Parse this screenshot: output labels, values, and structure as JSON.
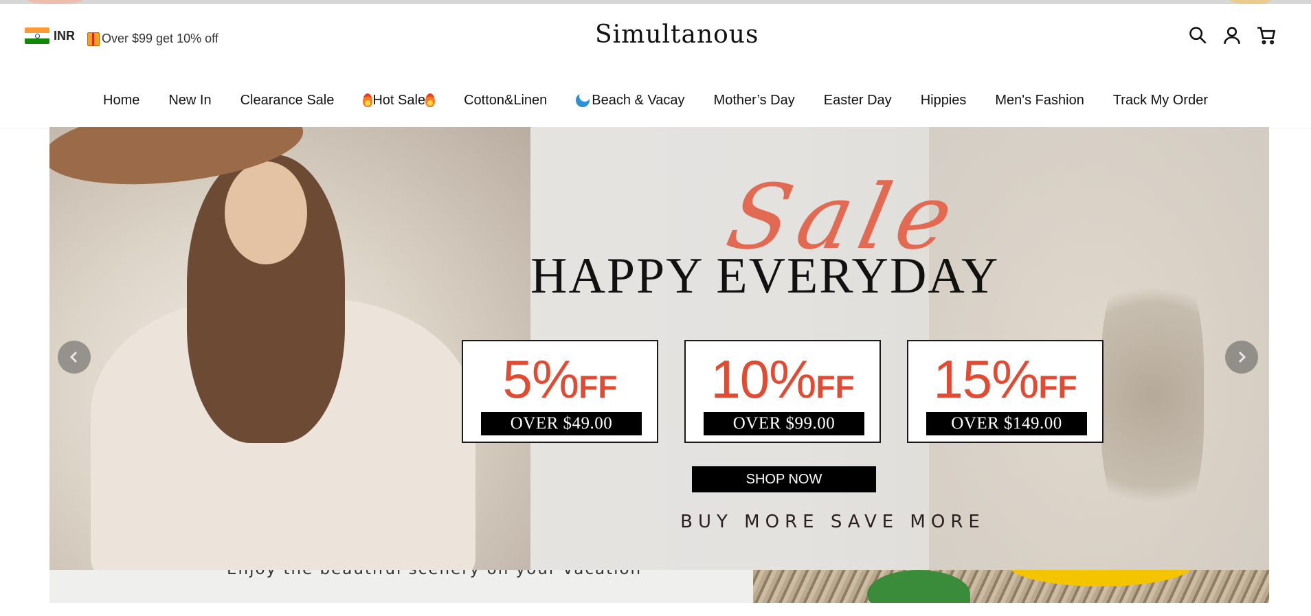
{
  "header": {
    "currency": {
      "code": "INR",
      "flag": "india-flag"
    },
    "promo_text": "Over $99 get 10% off",
    "logo": "Simultanous",
    "icons": [
      "search-icon",
      "account-icon",
      "cart-icon"
    ]
  },
  "nav": [
    {
      "label": "Home"
    },
    {
      "label": "New In"
    },
    {
      "label": "Clearance Sale"
    },
    {
      "label": "Hot Sale",
      "icon": "fire-icon"
    },
    {
      "label": "Cotton&Linen"
    },
    {
      "label": "Beach & Vacay",
      "icon": "wave-icon"
    },
    {
      "label": "Mother’s Day"
    },
    {
      "label": "Easter Day"
    },
    {
      "label": "Hippies"
    },
    {
      "label": "Men's Fashion"
    },
    {
      "label": "Track My Order"
    }
  ],
  "hero": {
    "script_title": "Sale",
    "headline": "HAPPY EVERYDAY",
    "coupons": [
      {
        "percent": "5%",
        "off": "FF",
        "condition": "OVER $49.00"
      },
      {
        "percent": "10%",
        "off": "FF",
        "condition": "OVER $99.00"
      },
      {
        "percent": "15%",
        "off": "FF",
        "condition": "OVER $149.00"
      }
    ],
    "cta": "SHOP NOW",
    "tagline": "BUY MORE SAVE MORE",
    "accent_color": "#e04b33"
  },
  "next_banner": {
    "text": "Enjoy the beautiful scenery on your vacation"
  }
}
